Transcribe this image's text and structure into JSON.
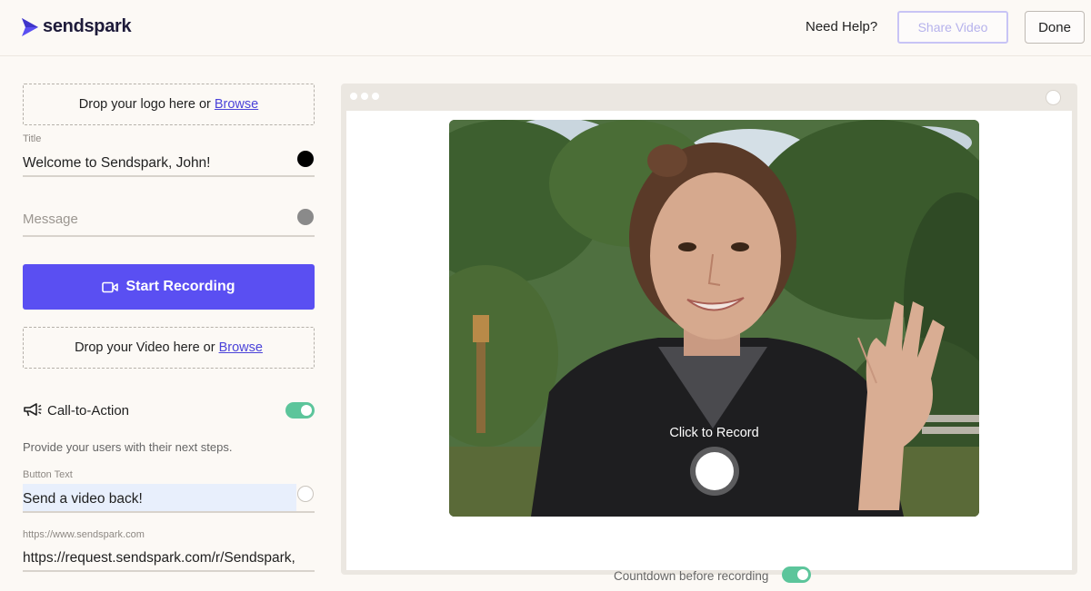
{
  "header": {
    "brand": "sendspark",
    "help": "Need Help?",
    "share_label": "Share Video",
    "done_label": "Done"
  },
  "logo_drop": {
    "text": "Drop your logo here or",
    "browse": "Browse"
  },
  "title_field": {
    "label": "Title",
    "value": "Welcome to Sendspark, John!",
    "color": "#000000"
  },
  "message_field": {
    "placeholder": "Message",
    "color": "#8a8a8a"
  },
  "record": {
    "label": "Start Recording",
    "color": "#5a4ff2"
  },
  "video_drop": {
    "text": "Drop your Video here or",
    "browse": "Browse"
  },
  "cta": {
    "label": "Call-to-Action",
    "enabled": true,
    "description": "Provide your users with their next steps.",
    "button_text_label": "Button Text",
    "button_text_value": "Send a video back!",
    "url_label": "https://www.sendspark.com",
    "url_value": "https://request.sendspark.com/r/Sendspark,"
  },
  "preview": {
    "record_prompt": "Click to Record",
    "countdown_label": "Countdown before recording",
    "countdown_enabled": true
  },
  "colors": {
    "accent": "#5a4ff2",
    "toggle_on": "#5cc59b",
    "link": "#4b43d9"
  }
}
